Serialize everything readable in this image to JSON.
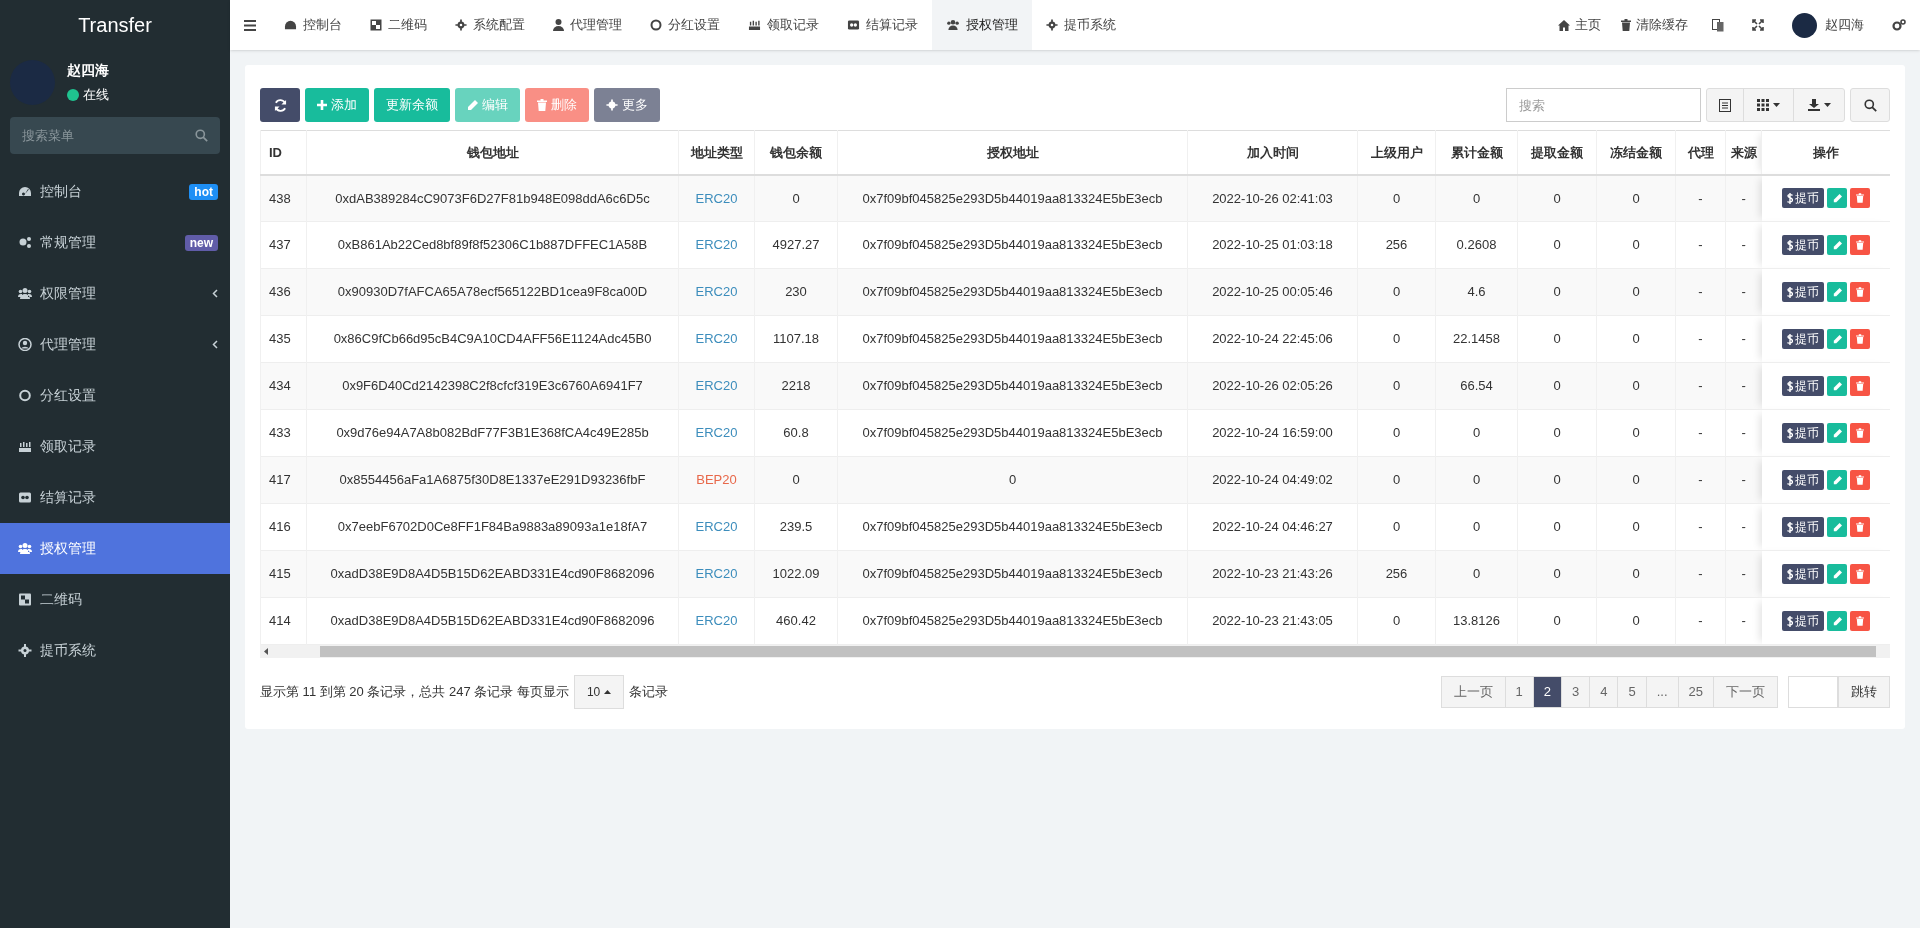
{
  "sidebar": {
    "brand": "Transfer",
    "user": {
      "name": "赵四海",
      "status": "在线"
    },
    "search_placeholder": "搜索菜单",
    "items": [
      {
        "label": "控制台",
        "badge": {
          "text": "hot",
          "color": "#1e8ff5"
        },
        "expandable": false,
        "selected": false
      },
      {
        "label": "常规管理",
        "badge": {
          "text": "new",
          "color": "#605ca8"
        },
        "expandable": false,
        "selected": false
      },
      {
        "label": "权限管理",
        "expandable": true,
        "selected": false
      },
      {
        "label": "代理管理",
        "expandable": true,
        "selected": false
      },
      {
        "label": "分红设置",
        "expandable": false,
        "selected": false
      },
      {
        "label": "领取记录",
        "expandable": false,
        "selected": false
      },
      {
        "label": "结算记录",
        "expandable": false,
        "selected": false
      },
      {
        "label": "授权管理",
        "expandable": false,
        "selected": true
      },
      {
        "label": "二维码",
        "expandable": false,
        "selected": false
      },
      {
        "label": "提币系统",
        "expandable": false,
        "selected": false
      }
    ]
  },
  "topbar": {
    "tabs": [
      {
        "label": "控制台",
        "selected": false
      },
      {
        "label": "二维码",
        "selected": false
      },
      {
        "label": "系统配置",
        "selected": false
      },
      {
        "label": "代理管理",
        "selected": false
      },
      {
        "label": "分红设置",
        "selected": false
      },
      {
        "label": "领取记录",
        "selected": false
      },
      {
        "label": "结算记录",
        "selected": false
      },
      {
        "label": "授权管理",
        "selected": true
      },
      {
        "label": "提币系统",
        "selected": false
      }
    ],
    "links": [
      {
        "label": "主页",
        "kind": "home"
      },
      {
        "label": "清除缓存",
        "kind": "trash"
      }
    ],
    "user_name": "赵四海"
  },
  "toolbar": {
    "buttons": [
      {
        "kind": "refresh",
        "disabled": false
      },
      {
        "kind": "add",
        "label": "添加",
        "disabled": false
      },
      {
        "kind": "update",
        "label": "更新余额",
        "disabled": false
      },
      {
        "kind": "edit",
        "label": "编辑",
        "disabled": true
      },
      {
        "kind": "delete",
        "label": "删除",
        "disabled": true
      },
      {
        "kind": "more",
        "label": "更多",
        "disabled": false
      }
    ],
    "search_placeholder": "搜索"
  },
  "table": {
    "columns": [
      "ID",
      "钱包地址",
      "地址类型",
      "钱包余额",
      "授权地址",
      "加入时间",
      "上级用户",
      "累计金额",
      "提取金额",
      "冻结金额",
      "代理",
      "来源",
      "操作"
    ],
    "rows": [
      {
        "cells": [
          "438",
          "0xdAB389284cC9073F6D27F81b948E098ddA6c6D5c",
          "ERC20",
          "0",
          "0x7f09bf045825e293D5b44019aa813324E5bE3ecb",
          "2022-10-26 02:41:03",
          "0",
          "0",
          "0",
          "0",
          "-",
          "-"
        ],
        "color": "#3c8dbc",
        "action": "提币"
      },
      {
        "cells": [
          "437",
          "0xB861Ab22Ced8bf89f8f52306C1b887DFFEC1A58B",
          "ERC20",
          "4927.27",
          "0x7f09bf045825e293D5b44019aa813324E5bE3ecb",
          "2022-10-25 01:03:18",
          "256",
          "0.2608",
          "0",
          "0",
          "-",
          "-"
        ],
        "color": "#3c8dbc",
        "action": "提币"
      },
      {
        "cells": [
          "436",
          "0x90930D7fAFCA65A78ecf565122BD1cea9F8ca00D",
          "ERC20",
          "230",
          "0x7f09bf045825e293D5b44019aa813324E5bE3ecb",
          "2022-10-25 00:05:46",
          "0",
          "4.6",
          "0",
          "0",
          "-",
          "-"
        ],
        "color": "#3c8dbc",
        "action": "提币"
      },
      {
        "cells": [
          "435",
          "0x86C9fCb66d95cB4C9A10CD4AFF56E1124Adc45B0",
          "ERC20",
          "1107.18",
          "0x7f09bf045825e293D5b44019aa813324E5bE3ecb",
          "2022-10-24 22:45:06",
          "0",
          "22.1458",
          "0",
          "0",
          "-",
          "-"
        ],
        "color": "#3c8dbc",
        "action": "提币"
      },
      {
        "cells": [
          "434",
          "0x9F6D40Cd2142398C2f8cfcf319E3c6760A6941F7",
          "ERC20",
          "2218",
          "0x7f09bf045825e293D5b44019aa813324E5bE3ecb",
          "2022-10-26 02:05:26",
          "0",
          "66.54",
          "0",
          "0",
          "-",
          "-"
        ],
        "color": "#3c8dbc",
        "action": "提币"
      },
      {
        "cells": [
          "433",
          "0x9d76e94A7A8b082BdF77F3B1E368fCA4c49E285b",
          "ERC20",
          "60.8",
          "0x7f09bf045825e293D5b44019aa813324E5bE3ecb",
          "2022-10-24 16:59:00",
          "0",
          "0",
          "0",
          "0",
          "-",
          "-"
        ],
        "color": "#3c8dbc",
        "action": "提币"
      },
      {
        "cells": [
          "417",
          "0x8554456aFa1A6875f30D8E1337eE291D93236fbF",
          "BEP20",
          "0",
          "0",
          "2022-10-24 04:49:02",
          "0",
          "0",
          "0",
          "0",
          "-",
          "-"
        ],
        "color": "#e8684a",
        "action": "提币"
      },
      {
        "cells": [
          "416",
          "0x7eebF6702D0Ce8FF1F84Ba9883a89093a1e18fA7",
          "ERC20",
          "239.5",
          "0x7f09bf045825e293D5b44019aa813324E5bE3ecb",
          "2022-10-24 04:46:27",
          "0",
          "0",
          "0",
          "0",
          "-",
          "-"
        ],
        "color": "#3c8dbc",
        "action": "提币"
      },
      {
        "cells": [
          "415",
          "0xadD38E9D8A4D5B15D62EABD331E4cd90F8682096",
          "ERC20",
          "1022.09",
          "0x7f09bf045825e293D5b44019aa813324E5bE3ecb",
          "2022-10-23 21:43:26",
          "256",
          "0",
          "0",
          "0",
          "-",
          "-"
        ],
        "color": "#3c8dbc",
        "action": "提币"
      },
      {
        "cells": [
          "414",
          "0xadD38E9D8A4D5B15D62EABD331E4cd90F8682096",
          "ERC20",
          "460.42",
          "0x7f09bf045825e293D5b44019aa813324E5bE3ecb",
          "2022-10-23 21:43:05",
          "0",
          "13.8126",
          "0",
          "0",
          "-",
          "-"
        ],
        "color": "#3c8dbc",
        "action": "提币"
      }
    ]
  },
  "footer": {
    "summary": "显示第 11 到第 20 条记录，总共 247 条记录 每页显示",
    "page_size": "10",
    "suffix": "条记录",
    "prev": "上一页",
    "next": "下一页",
    "jump": "跳转",
    "pages": [
      {
        "label": "1",
        "selected": false
      },
      {
        "label": "2",
        "selected": true
      },
      {
        "label": "3",
        "selected": false
      },
      {
        "label": "4",
        "selected": false
      },
      {
        "label": "5",
        "selected": false
      },
      {
        "label": "...",
        "selected": false
      },
      {
        "label": "25",
        "selected": false
      }
    ]
  }
}
